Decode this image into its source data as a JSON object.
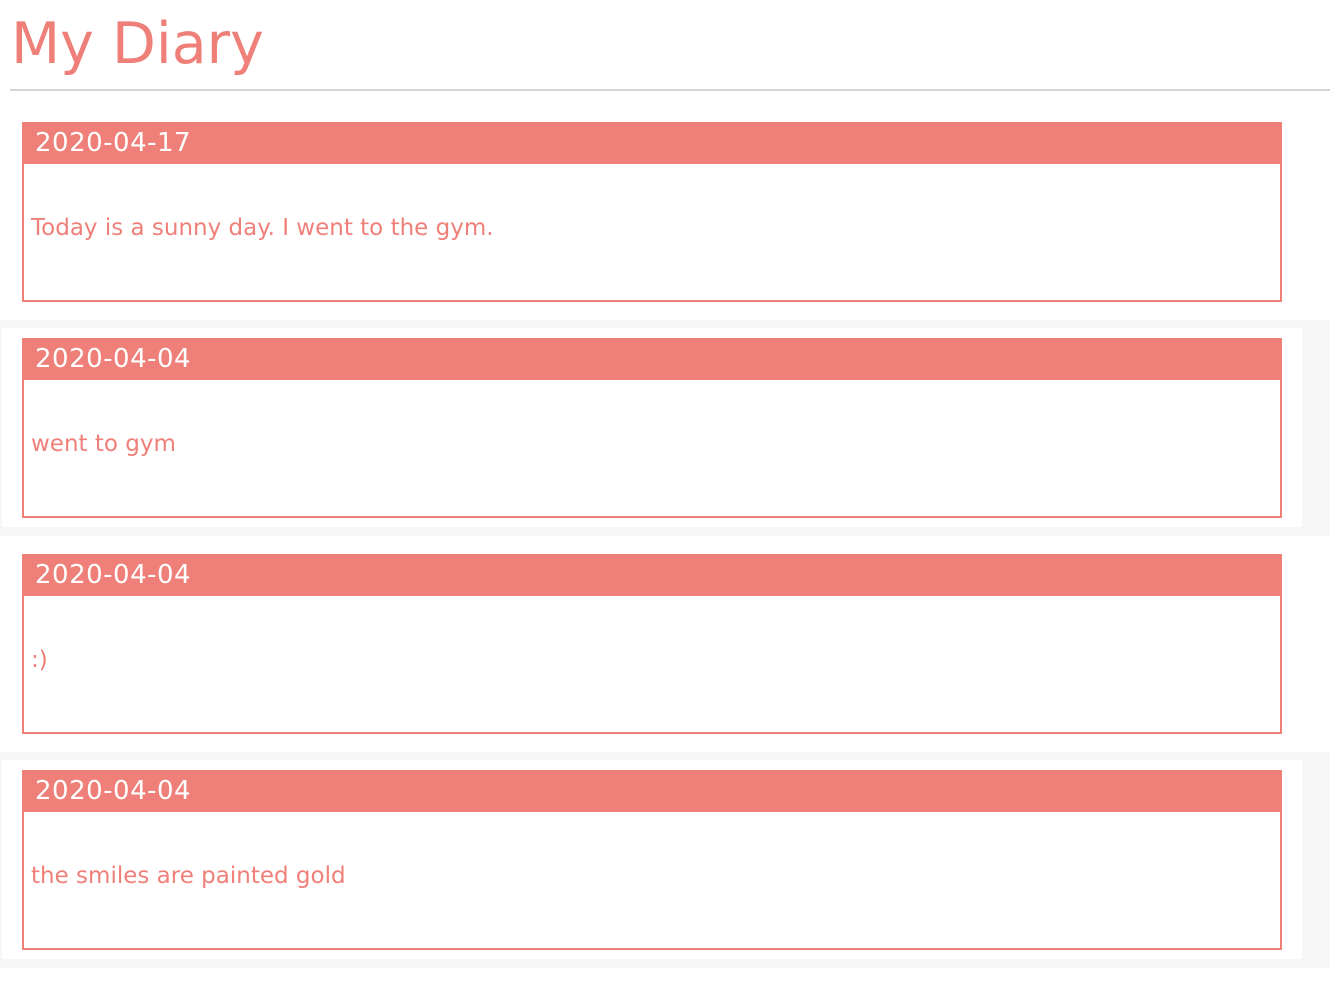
{
  "app": {
    "title": "My Diary"
  },
  "colors": {
    "accent": "#ef8079",
    "divider": "#d4d4d4",
    "shade": "#f7f7f7"
  },
  "entries": [
    {
      "date": "2020-04-17",
      "text": "Today is a sunny day. I went to the gym."
    },
    {
      "date": "2020-04-04",
      "text": "went to gym"
    },
    {
      "date": "2020-04-04",
      "text": ":)"
    },
    {
      "date": "2020-04-04",
      "text": "the smiles are painted gold"
    }
  ]
}
